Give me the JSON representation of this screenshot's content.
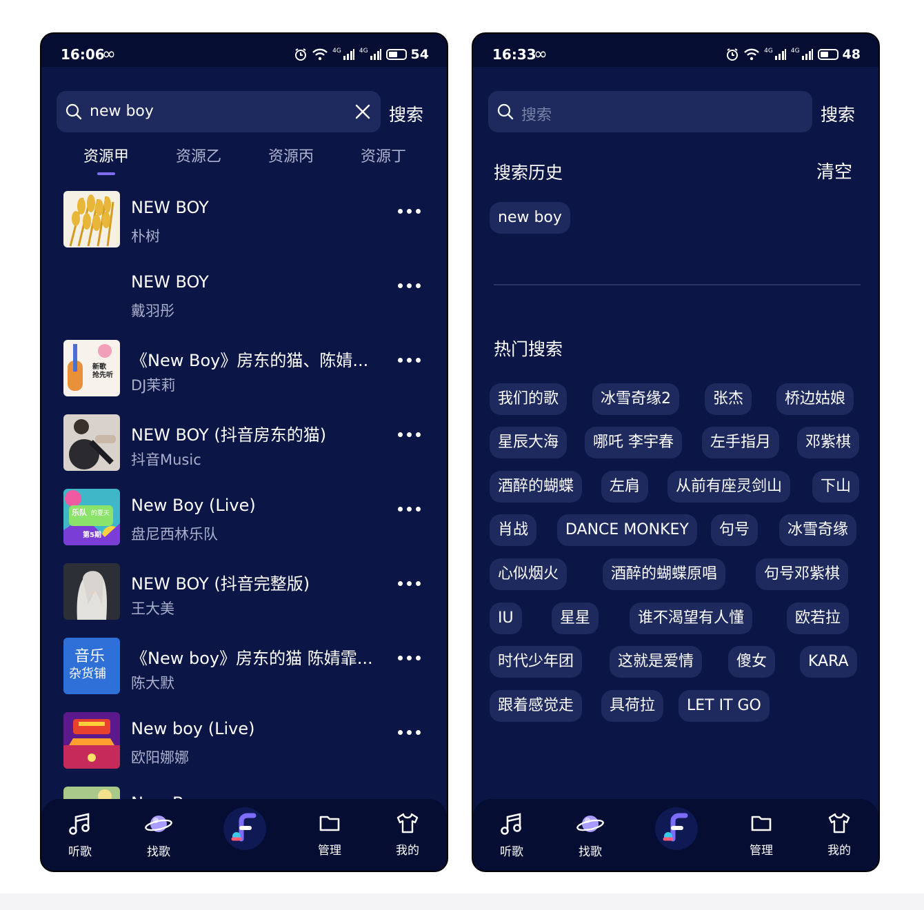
{
  "left": {
    "status": {
      "time": "16:06",
      "signal1": "4G",
      "signal2": "4G",
      "battery": "54"
    },
    "search": {
      "value": "new boy",
      "button": "搜索"
    },
    "tabs": [
      "资源甲",
      "资源乙",
      "资源丙",
      "资源丁"
    ],
    "songs": [
      {
        "title": "NEW BOY",
        "artist": "朴树"
      },
      {
        "title": "NEW BOY",
        "artist": "戴羽彤"
      },
      {
        "title": "《New Boy》房东的猫、陈婧...",
        "artist": "DJ茉莉"
      },
      {
        "title": "NEW BOY (抖音房东的猫)",
        "artist": "抖音Music"
      },
      {
        "title": "New Boy (Live)",
        "artist": "盘尼西林乐队"
      },
      {
        "title": "NEW BOY (抖音完整版)",
        "artist": "王大美"
      },
      {
        "title": "《New boy》房东的猫 陈婧霏...",
        "artist": "陈大默"
      },
      {
        "title": "New boy (Live)",
        "artist": "欧阳娜娜"
      },
      {
        "title": "New Boy",
        "artist": ""
      }
    ],
    "covers": {
      "c3_line1": "新歌",
      "c3_line2": "抢先听",
      "c5_line1": "乐队",
      "c5_line2": "的夏天",
      "c5_line3": "第5期",
      "c7_line1": "音乐",
      "c7_line2": "杂货铺"
    }
  },
  "right": {
    "status": {
      "time": "16:33",
      "signal1": "4G",
      "signal2": "4G",
      "battery": "48"
    },
    "search": {
      "placeholder": "搜索",
      "button": "搜索"
    },
    "history": {
      "title": "搜索历史",
      "clear": "清空",
      "items": [
        "new boy"
      ]
    },
    "hot": {
      "title": "热门搜索",
      "items": [
        "我们的歌",
        "冰雪奇缘2",
        "张杰",
        "桥边姑娘",
        "星辰大海",
        "哪吒 李宇春",
        "左手指月",
        "邓紫棋",
        "酒醉的蝴蝶",
        "左肩",
        "从前有座灵剑山",
        "下山",
        "肖战",
        "DANCE MONKEY",
        "句号",
        "冰雪奇缘",
        "心似烟火",
        "酒醉的蝴蝶原唱",
        "句号邓紫棋",
        "IU",
        "星星",
        "谁不渴望有人懂",
        "欧若拉",
        "时代少年团",
        "这就是爱情",
        "傻女",
        "KARA",
        "跟着感觉走",
        "具荷拉",
        "LET IT GO"
      ]
    }
  },
  "tabbar": {
    "listen": "听歌",
    "find": "找歌",
    "manage": "管理",
    "mine": "我的"
  },
  "colors": {
    "background": "#0c1646",
    "statusbar": "#050d32",
    "chip": "#1e2a5e",
    "accent": "#7f6bf0"
  },
  "battery_levels": {
    "left": 0.54,
    "right": 0.48
  }
}
